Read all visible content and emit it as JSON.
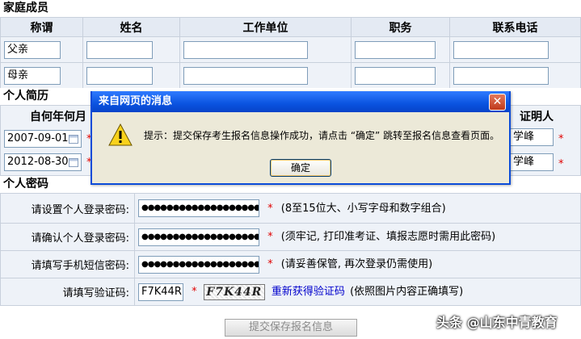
{
  "family": {
    "title": "家庭成员",
    "headers": [
      "称谓",
      "姓名",
      "工作单位",
      "职务",
      "联系电话"
    ],
    "rows": [
      {
        "relation": "父亲",
        "name": "",
        "work": "",
        "position": "",
        "phone": ""
      },
      {
        "relation": "母亲",
        "name": "",
        "work": "",
        "position": "",
        "phone": ""
      }
    ]
  },
  "resume": {
    "title": "个人简历",
    "header_from": "自何年何月",
    "header_witness": "证明人",
    "rows": [
      {
        "date": "2007-09-01",
        "witness": "学峰"
      },
      {
        "date": "2012-08-30",
        "witness": "学峰"
      }
    ]
  },
  "password": {
    "title": "个人密码",
    "rows": [
      {
        "label": "请设置个人登录密码:",
        "value": "●●●●●●●●●●●●●●●●●●●●",
        "hint": "(8至15位大、小写字母和数字组合)"
      },
      {
        "label": "请确认个人登录密码:",
        "value": "●●●●●●●●●●●●●●●●●●●●",
        "hint": "(须牢记, 打印准考证、填报志愿时需用此密码)"
      },
      {
        "label": "请填写手机短信密码:",
        "value": "●●●●●●●●●●●●●●●●●●●●",
        "hint": "(请妥善保管, 再次登录仍需使用)"
      }
    ],
    "captcha": {
      "label": "请填写验证码:",
      "value": "F7K44R",
      "image_text": "F7K44R",
      "refresh_link": "重新获得验证码",
      "hint": "(依照图片内容正确填写)"
    },
    "required_mark": "*"
  },
  "submit_label": "提交保存报名信息",
  "dialog": {
    "title": "来自网页的消息",
    "message": "提示：提交保存考生报名信息操作成功，请点击 “确定” 跳转至报名信息查看页面。",
    "ok_label": "确定",
    "close_glyph": "✕"
  },
  "watermark": "头条 @山东中青教育"
}
